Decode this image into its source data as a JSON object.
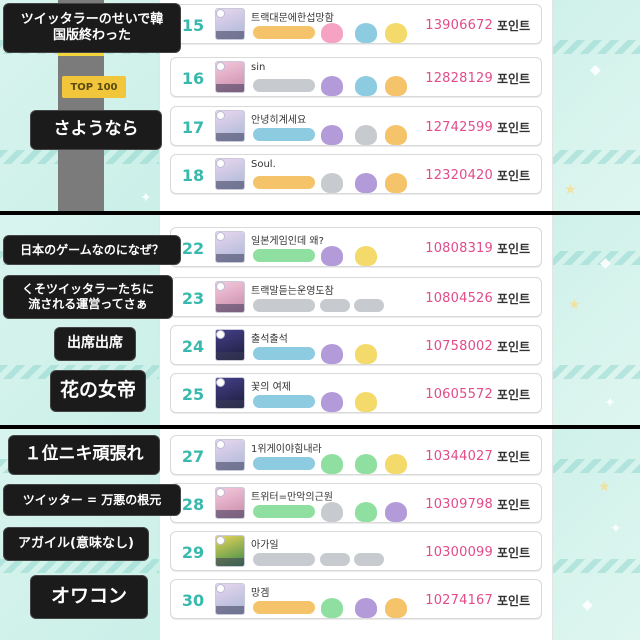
{
  "panel_a": {
    "top_badge": "TOP 100",
    "captions": [
      "ツイッタラーのせいで韓\n国版終わった",
      "さようなら"
    ],
    "rows": [
      {
        "rank": "15",
        "name": "트랙대문에한섭망함",
        "score": "13906672",
        "unit": "포인트"
      },
      {
        "rank": "16",
        "name": "sin",
        "score": "12828129",
        "unit": "포인트"
      },
      {
        "rank": "17",
        "name": "안녕히계세요",
        "score": "12742599",
        "unit": "포인트"
      },
      {
        "rank": "18",
        "name": "Soul.",
        "score": "12320420",
        "unit": "포인트"
      }
    ]
  },
  "panel_b": {
    "captions": [
      "日本のゲームなのになぜ？",
      "くそツイッタラーたちに\n流される運営ってさぁ",
      "出席出席",
      "花の女帝"
    ],
    "rows": [
      {
        "rank": "22",
        "name": "일본게임인데 왜?",
        "score": "10808319",
        "unit": "포인트"
      },
      {
        "rank": "23",
        "name": "트랙말듣는운영도참",
        "score": "10804526",
        "unit": "포인트"
      },
      {
        "rank": "24",
        "name": "출석출석",
        "score": "10758002",
        "unit": "포인트"
      },
      {
        "rank": "25",
        "name": "꽃의 여제",
        "score": "10605572",
        "unit": "포인트"
      }
    ]
  },
  "panel_c": {
    "captions": [
      "１位ニキ頑張れ",
      "ツイッター = 万悪の根元",
      "アガイル(意味なし)",
      "オワコン"
    ],
    "rows": [
      {
        "rank": "27",
        "name": "1위게이야힘내라",
        "score": "10344027",
        "unit": "포인트"
      },
      {
        "rank": "28",
        "name": "트위터=만악의근원",
        "score": "10309798",
        "unit": "포인트"
      },
      {
        "rank": "29",
        "name": "아가일",
        "score": "10300099",
        "unit": "포인트"
      },
      {
        "rank": "30",
        "name": "망겜",
        "score": "10274167",
        "unit": "포인트"
      }
    ]
  },
  "colors": {
    "rank": "#39b9ad",
    "score": "#e14c8a",
    "caption_bg": "#1b1b1b",
    "panel_bg": "#d9f4ee"
  }
}
